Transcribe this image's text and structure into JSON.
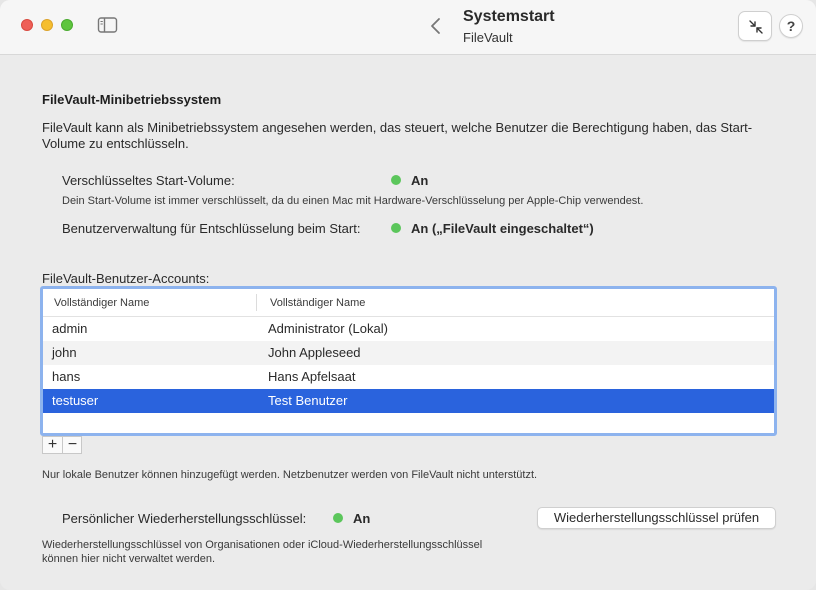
{
  "window": {
    "title": "Systemstart",
    "subtitle": "FileVault",
    "help_label": "?"
  },
  "section": {
    "heading": "FileVault-Minibetriebssystem",
    "description": "FileVault kann als Minibetriebssystem angesehen werden, das steuert, welche Benutzer die Berechtigung haben, das Start-Volume zu entschlüsseln."
  },
  "encrypted_volume": {
    "label": "Verschlüsseltes Start-Volume:",
    "value": "An",
    "note": "Dein Start-Volume ist immer verschlüsselt, da du einen Mac mit Hardware-Verschlüsselung per Apple-Chip verwendest.",
    "status_color": "#5bc65b"
  },
  "user_management": {
    "label": "Benutzerverwaltung für Entschlüsselung beim Start:",
    "value": "An („FileVault eingeschaltet“)",
    "status_color": "#5bc65b"
  },
  "accounts": {
    "label": "FileVault-Benutzer-Accounts:",
    "columns": [
      "Vollständiger Name",
      "Vollständiger Name"
    ],
    "rows": [
      {
        "short": "admin",
        "full": "Administrator (Lokal)"
      },
      {
        "short": "john",
        "full": "John Appleseed"
      },
      {
        "short": "hans",
        "full": "Hans Apfelsaat"
      },
      {
        "short": "testuser",
        "full": "Test Benutzer"
      }
    ],
    "selected_index": 3,
    "add_label": "+",
    "remove_label": "−",
    "note": "Nur lokale Benutzer können hinzugefügt werden. Netzbenutzer werden von FileVault nicht unterstützt."
  },
  "recovery": {
    "label": "Persönlicher Wiederherstellungsschlüssel:",
    "value": "An",
    "button_label": "Wiederherstellungsschlüssel prüfen",
    "note_line1": "Wiederherstellungsschlüssel von Organisationen oder iCloud-Wiederherstellungsschlüssel",
    "note_line2": "können hier nicht verwaltet werden.",
    "status_color": "#5bc65b"
  },
  "colors": {
    "selection": "#2a63dd",
    "focus_ring": "#8db3ee",
    "status_on": "#5bc65b"
  }
}
